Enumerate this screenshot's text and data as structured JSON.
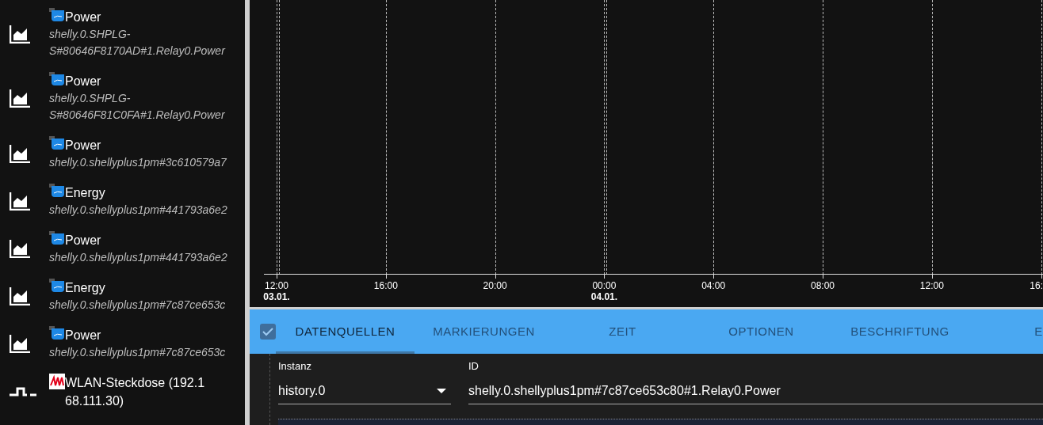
{
  "sidebar": {
    "items": [
      {
        "kind": "chart",
        "badge": {
          "kind": "shelly"
        },
        "title": "Power",
        "subtitle": "shelly.0.SHPLG-S#80646F8170AD#1.Relay0.Power"
      },
      {
        "kind": "chart",
        "badge": {
          "kind": "shelly"
        },
        "title": "Power",
        "subtitle": "shelly.0.SHPLG-S#80646F81C0FA#1.Relay0.Power"
      },
      {
        "kind": "chart",
        "badge": {
          "kind": "shelly"
        },
        "title": "Power",
        "subtitle": "shelly.0.shellyplus1pm#3c610579a7"
      },
      {
        "kind": "chart",
        "badge": {
          "kind": "shelly"
        },
        "title": "Energy",
        "subtitle": "shelly.0.shellyplus1pm#441793a6e2"
      },
      {
        "kind": "chart",
        "badge": {
          "kind": "shelly"
        },
        "title": "Power",
        "subtitle": "shelly.0.shellyplus1pm#441793a6e2"
      },
      {
        "kind": "chart",
        "badge": {
          "kind": "shelly"
        },
        "title": "Energy",
        "subtitle": "shelly.0.shellyplus1pm#7c87ce653c"
      },
      {
        "kind": "chart",
        "badge": {
          "kind": "shelly"
        },
        "title": "Power",
        "subtitle": "shelly.0.shellyplus1pm#7c87ce653c"
      },
      {
        "kind": "pulse",
        "badge": {
          "kind": "avm"
        },
        "title": "WLAN-Steckdose (192.168.111.30)"
      }
    ]
  },
  "chart": {
    "ticks": [
      {
        "time": "12:00",
        "date": "03.01."
      },
      {
        "time": "16:00"
      },
      {
        "time": "20:00"
      },
      {
        "time": "00:00",
        "date": "04.01."
      },
      {
        "time": "04:00"
      },
      {
        "time": "08:00"
      },
      {
        "time": "12:00"
      },
      {
        "time": "16:"
      }
    ]
  },
  "editor": {
    "enabled": true,
    "tabs": [
      {
        "label": "DATENQUELLEN",
        "selected": true
      },
      {
        "label": "MARKIERUNGEN",
        "selected": false
      },
      {
        "label": "ZEIT",
        "selected": false
      },
      {
        "label": "OPTIONEN",
        "selected": false
      },
      {
        "label": "BESCHRIFTUNG",
        "selected": false
      },
      {
        "label": "E",
        "selected": false
      }
    ],
    "instance": {
      "label": "Instanz",
      "value": "history.0"
    },
    "id": {
      "label": "ID",
      "value": "shelly.0.shellyplus1pm#7c87ce653c80#1.Relay0.Power"
    }
  }
}
